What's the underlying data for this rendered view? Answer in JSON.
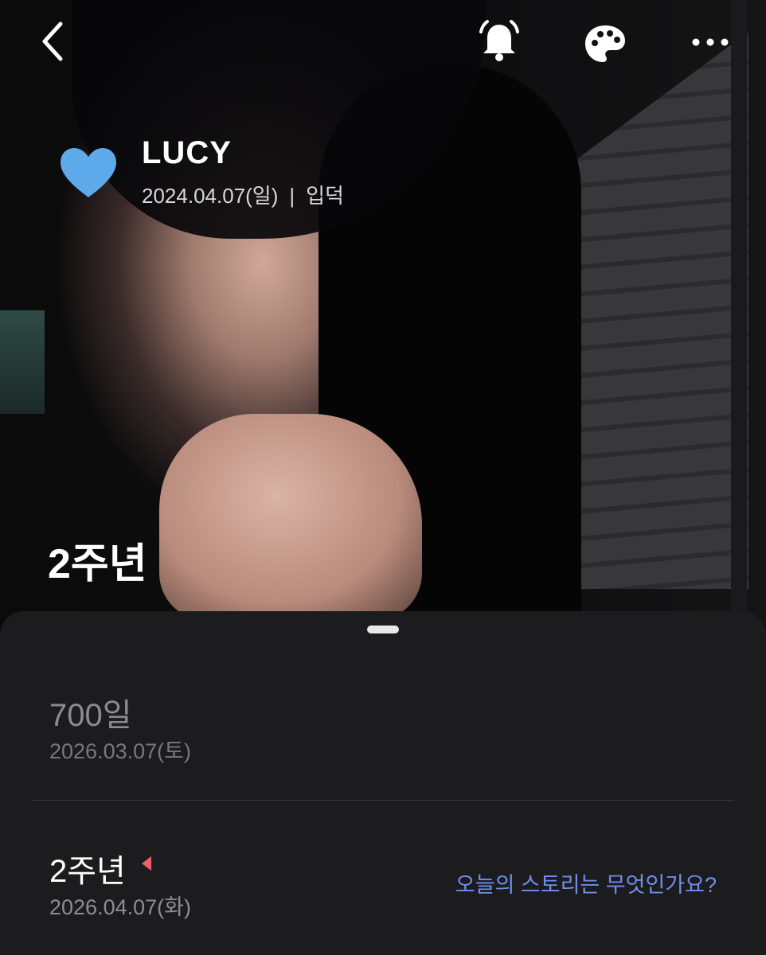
{
  "header": {
    "icons": [
      "back-icon",
      "bell-icon",
      "palette-icon",
      "more-icon"
    ]
  },
  "profile": {
    "name": "LUCY",
    "date": "2024.04.07(일)",
    "separator": "|",
    "label": "입덕",
    "heart_color": "#5ea9ea"
  },
  "hero": {
    "milestone": "2주년"
  },
  "sheet": {
    "items": [
      {
        "title": "700일",
        "date": "2026.03.07(토)"
      },
      {
        "title": "2주년",
        "date": "2026.04.07(화)",
        "action": "오늘의 스토리는 무엇인가요?",
        "marker_color": "#ef5f6b"
      }
    ],
    "link_color": "#6f8eef"
  }
}
